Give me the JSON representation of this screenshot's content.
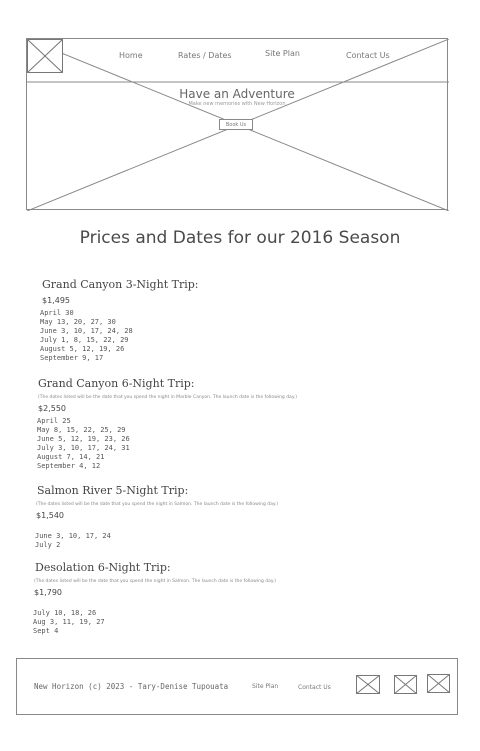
{
  "nav": {
    "items": [
      {
        "label": "Home"
      },
      {
        "label": "Rates / Dates"
      },
      {
        "label": "Site Plan"
      },
      {
        "label": "Contact Us"
      }
    ]
  },
  "hero": {
    "title": "Have an Adventure",
    "subtitle": "Make new memories with New Horizon",
    "button_label": "Book Us"
  },
  "page_title": "Prices and Dates for our 2016 Season",
  "trips": [
    {
      "name": "Grand Canyon 3-Night Trip:",
      "note": "",
      "price": "$1,495",
      "dates": [
        "April 30",
        "May 13, 20, 27, 30",
        "June 3, 10, 17, 24, 28",
        "July 1, 8, 15, 22, 29",
        "August 5, 12, 19, 26",
        "September 9, 17"
      ]
    },
    {
      "name": "Grand Canyon 6-Night Trip:",
      "note": "(The dates listed will be the date that you spend the night in Marble Canyon. The launch date is the following day.)",
      "price": "$2,550",
      "dates": [
        "April 25",
        "May 8, 15, 22, 25, 29",
        "June 5, 12, 19, 23, 26",
        "July 3, 10, 17, 24, 31",
        "August 7, 14, 21",
        "September 4, 12"
      ]
    },
    {
      "name": "Salmon River 5-Night Trip:",
      "note": "(The dates listed will be the date that you spend the night in Salmon. The launch date is the following day.)",
      "price": "$1,540",
      "dates": [
        "",
        "June 3, 10, 17, 24",
        "July 2"
      ]
    },
    {
      "name": "Desolation 6-Night Trip:",
      "note": "(The dates listed will be the date that you spend the night in Salmon. The launch date is the following day.)",
      "price": "$1,790",
      "dates": [
        "",
        "July 10, 18, 26",
        "Aug 3, 11, 19, 27",
        "Sept 4"
      ]
    }
  ],
  "footer": {
    "copyright": "New Horizon (c) 2023 - Tary-Denise Tupouata",
    "links": [
      {
        "label": "Site Plan"
      },
      {
        "label": "Contact Us"
      }
    ],
    "social_icons": [
      "image-placeholder-icon",
      "image-placeholder-icon",
      "image-placeholder-icon"
    ]
  }
}
